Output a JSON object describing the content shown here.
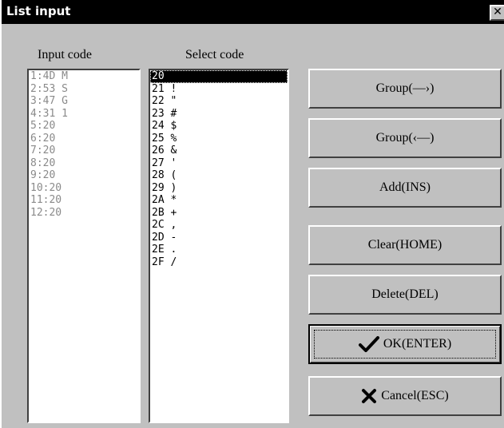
{
  "window": {
    "title": "List input",
    "close_label": "✕"
  },
  "input_list": {
    "label": "Input code",
    "items": [
      "1:4D M",
      "2:53 S",
      "3:47 G",
      "4:31 1",
      "5:20",
      "6:20",
      "7:20",
      "8:20",
      "9:20",
      "10:20",
      "11:20",
      "12:20"
    ]
  },
  "select_list": {
    "label": "Select code",
    "selected": "20",
    "items": [
      "20",
      "21 !",
      "22 \"",
      "23 #",
      "24 $",
      "25 %",
      "26 &",
      "27 '",
      "28 (",
      "29 )",
      "2A *",
      "2B +",
      "2C ,",
      "2D -",
      "2E .",
      "2F /"
    ]
  },
  "buttons": {
    "group_forward": "Group(—›)",
    "group_back": "Group(‹—)",
    "add": "Add(INS)",
    "clear": "Clear(HOME)",
    "delete": "Delete(DEL)",
    "ok": "OK(ENTER)",
    "cancel": "Cancel(ESC)"
  },
  "icons": {
    "ok": "check-icon",
    "cancel": "x-icon",
    "ok_color": "#000000",
    "cancel_color": "#000000"
  }
}
